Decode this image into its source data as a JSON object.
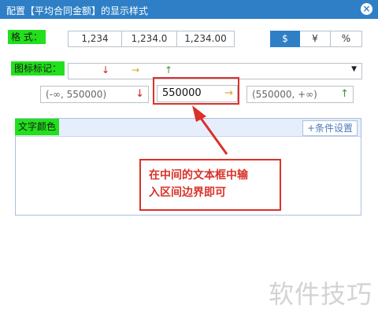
{
  "window": {
    "title": "配置【平均合同金额】的显示样式",
    "close_label": "×"
  },
  "format": {
    "label": "格 式：",
    "number_options": [
      "1,234",
      "1,234.0",
      "1,234.00"
    ],
    "currency_options": [
      "$",
      "¥",
      "%"
    ],
    "selected_currency": "$"
  },
  "chart_mark": {
    "label": "图标标记：",
    "arrows": [
      "↓",
      "→",
      "↑"
    ],
    "arrow_colors": [
      "#c8231c",
      "#e0a020",
      "#3a9a2a"
    ]
  },
  "range": {
    "left_text": "(-∞, 550000)",
    "middle_value": "550000",
    "right_text": "(550000, +∞)"
  },
  "text_color": {
    "label": "文字颜色",
    "condition_button": "+条件设置"
  },
  "annotation": {
    "line1": "在中间的文本框中输",
    "line2": "入区间边界即可"
  },
  "watermark": "软件技巧"
}
